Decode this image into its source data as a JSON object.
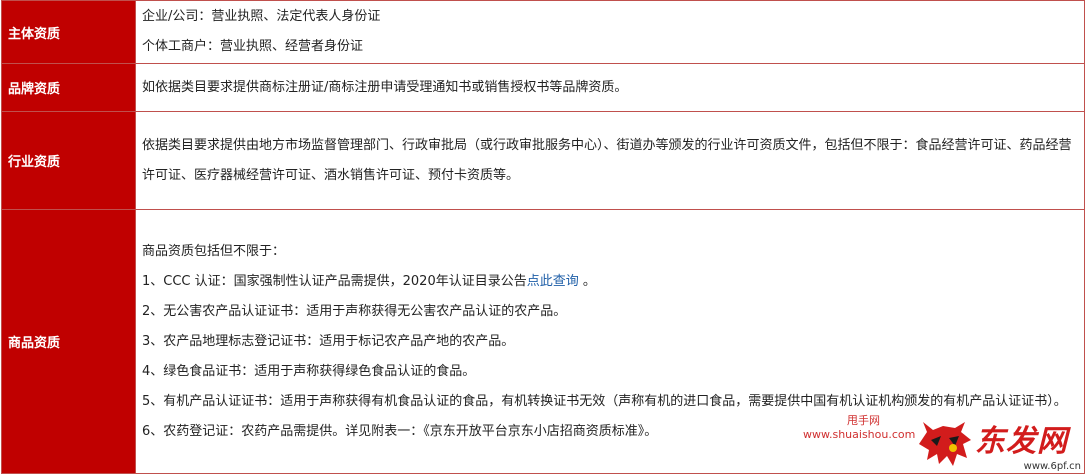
{
  "rows": [
    {
      "label": "主体资质",
      "lines": [
        "企业/公司：营业执照、法定代表人身份证",
        "个体工商户：营业执照、经营者身份证"
      ]
    },
    {
      "label": "品牌资质",
      "lines": [
        "如依据类目要求提供商标注册证/商标注册申请受理通知书或销售授权书等品牌资质。"
      ]
    },
    {
      "label": "行业资质",
      "paragraph": "依据类目要求提供由地方市场监督管理部门、行政审批局（或行政审批服务中心）、街道办等颁发的行业许可资质文件，包括但不限于：食品经营许可证、药品经营许可证、医疗器械经营许可证、酒水销售许可证、预付卡资质等。"
    },
    {
      "label": "商品资质",
      "intro": "商品资质包括但不限于：",
      "item1_prefix": "1、CCC 认证：国家强制性认证产品需提供，2020年认证目录公告",
      "item1_link": "点此查询",
      "item1_suffix": " 。",
      "item2": "2、无公害农产品认证证书：适用于声称获得无公害农产品认证的农产品。",
      "item3": "3、农产品地理标志登记证书：适用于标记农产品产地的农产品。",
      "item4": "4、绿色食品证书：适用于声称获得绿色食品认证的食品。",
      "item5": "5、有机产品认证证书：适用于声称获得有机食品认证的食品，有机转换证书无效（声称有机的进口食品，需要提供中国有机认证机构颁发的有机产品认证证书）。",
      "item6": "6、农药登记证：农药产品需提供。详见附表一：《京东开放平台京东小店招商资质标准》。"
    }
  ],
  "watermark": {
    "site_cn": "甩手网",
    "site_url": "www.shuaishou.com",
    "brand": "东发网",
    "brand_url": "www.6pf.cn",
    "accent_color": "#d21c1c"
  },
  "colors": {
    "label_bg": "#c00000",
    "border": "#c0504d",
    "link": "#1f5fa8"
  }
}
